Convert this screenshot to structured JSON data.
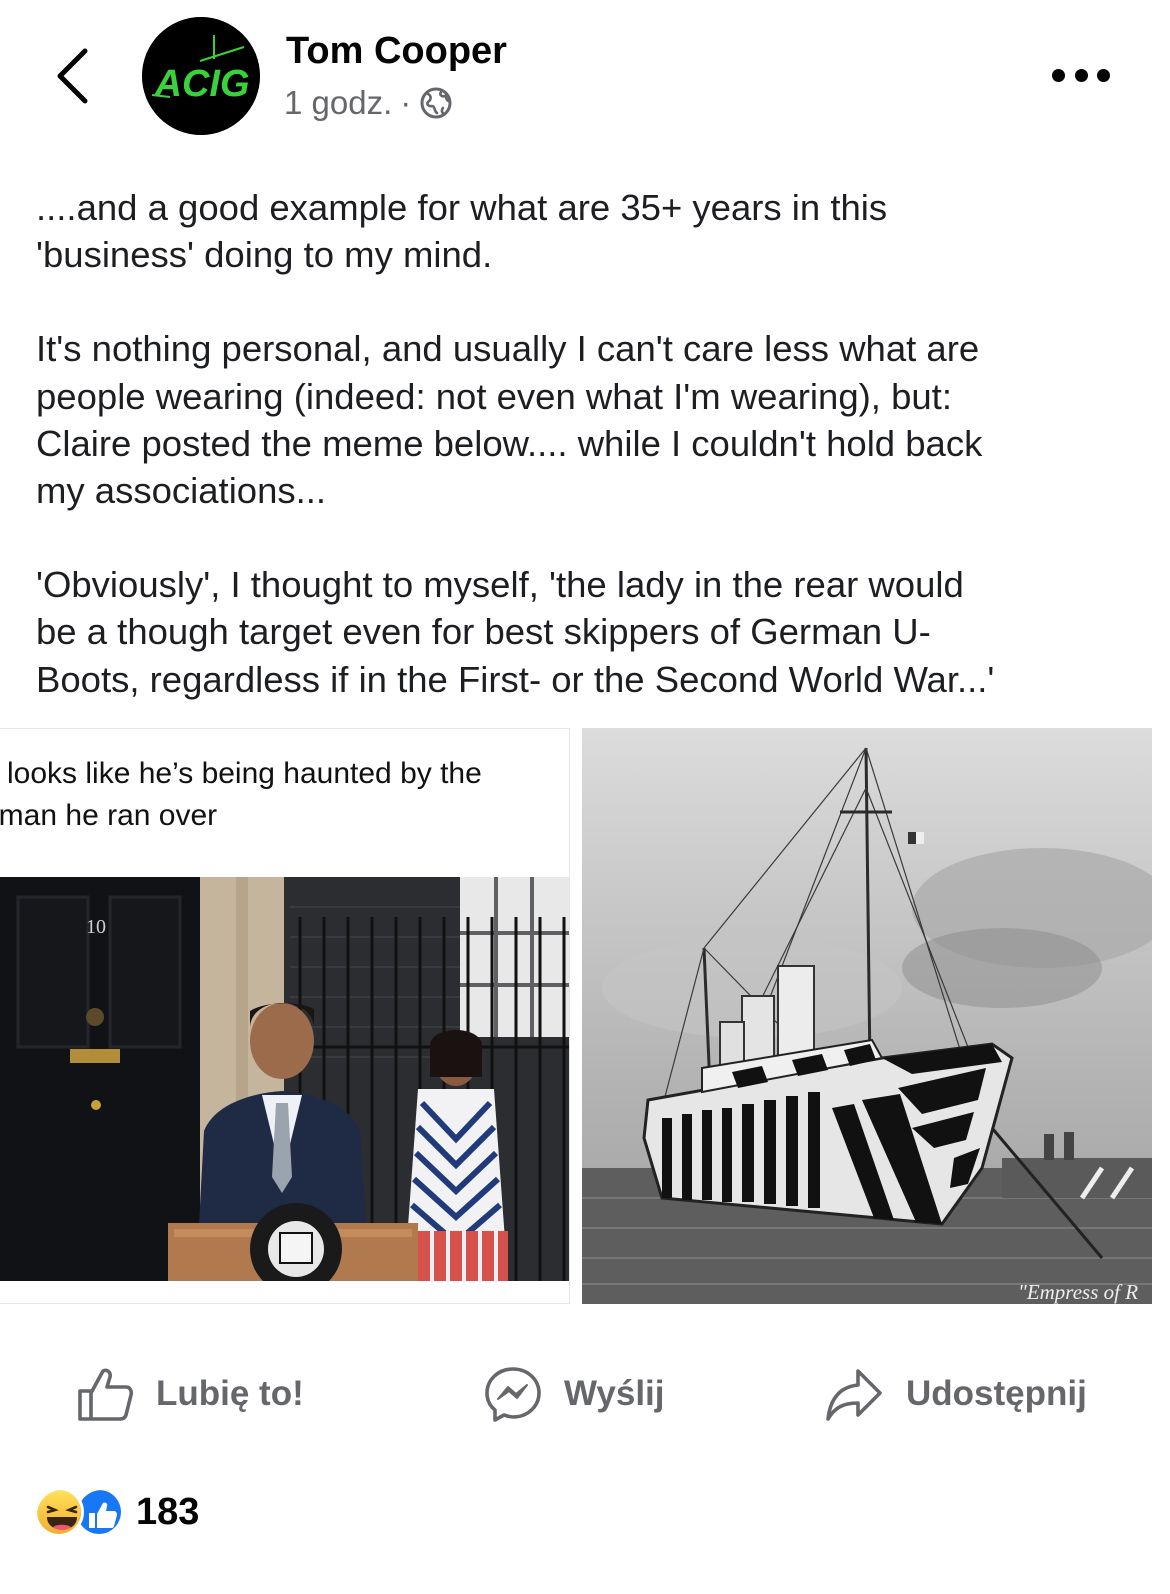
{
  "post": {
    "author": "Tom Cooper",
    "avatar_text": "ACIG",
    "time": "1 godz.",
    "separator": "·",
    "audience_icon": "globe-icon",
    "paragraphs": [
      "....and a good example for what are 35+ years in this\n'business' doing to my mind.",
      "It's nothing personal, and usually I can't care less what are\npeople wearing (indeed: not even what I'm wearing), but:\nClaire posted the meme below.... while I couldn't hold back\nmy associations...",
      "'Obviously', I thought to myself, 'the lady in the rear would\nbe a though target even for best skippers of German U-\nBoots, regardless if in the First- or the Second World War...'"
    ]
  },
  "images": {
    "meme": {
      "caption": "e looks like he’s being haunted by the\noman he ran over",
      "door_number": "10"
    },
    "ship": {
      "caption": "\"Empress of R"
    }
  },
  "actions": {
    "like": "Lubię to!",
    "send": "Wyślij",
    "share": "Udostępnij"
  },
  "reactions": {
    "icons": [
      "haha-icon",
      "like-icon"
    ],
    "count": "183"
  },
  "colors": {
    "secondary_text": "#65676b",
    "like_blue": "#1877f2",
    "avatar_green": "#39d23a"
  }
}
